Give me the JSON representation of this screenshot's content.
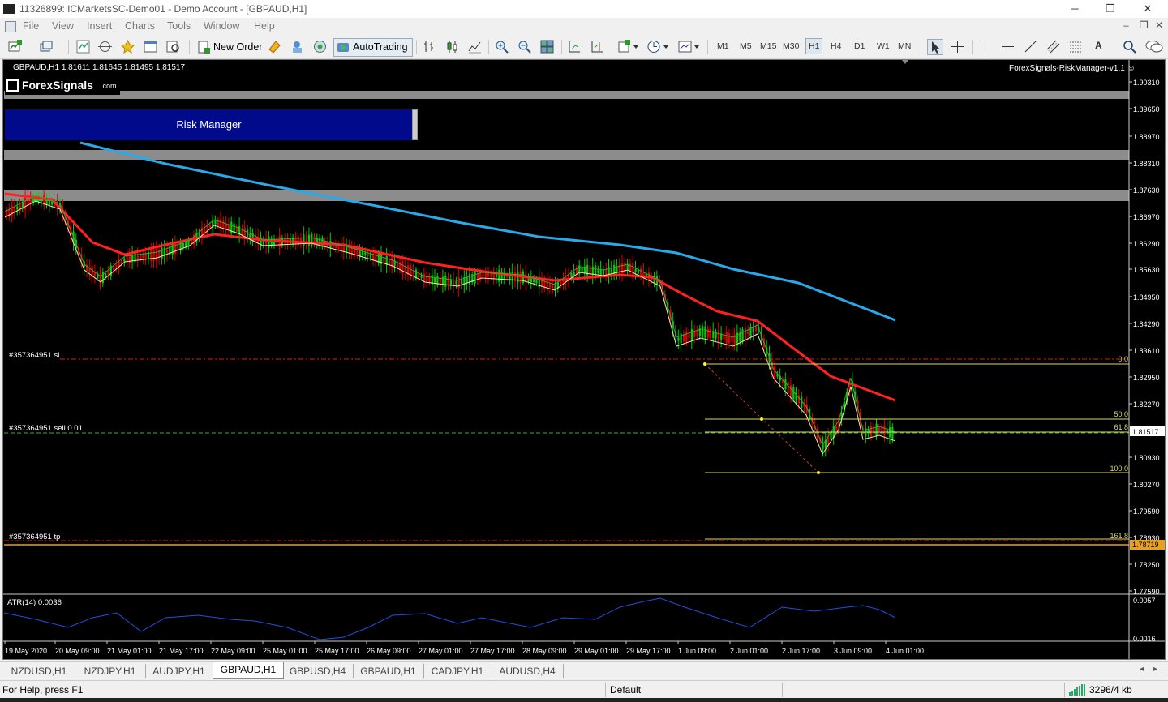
{
  "window": {
    "title": "11326899: ICMarketsSC-Demo01 - Demo Account - [GBPAUD,H1]",
    "minimize": "─",
    "restore": "❐",
    "close": "✕"
  },
  "menu": {
    "items": [
      "File",
      "View",
      "Insert",
      "Charts",
      "Tools",
      "Window",
      "Help"
    ],
    "mdi_min": "‒",
    "mdi_restore": "❐",
    "mdi_close": "✕"
  },
  "toolbar": {
    "new_order": "New Order",
    "autotrading": "AutoTrading",
    "timeframes": [
      "M1",
      "M5",
      "M15",
      "M30",
      "H1",
      "H4",
      "D1",
      "W1",
      "MN"
    ],
    "active_timeframe": "H1",
    "text_tool": "A"
  },
  "chart": {
    "info": "GBPAUD,H1  1.81611 1.81645 1.81495 1.81517",
    "ea_label": "ForexSignals-RiskManager-v1.1 ☺",
    "logo_text": "ForexSignals",
    "logo_suffix": ".com",
    "risk_manager_label": "Risk Manager",
    "order_sl": "#357364951 sl",
    "order_sell": "#357364951 sell 0.01",
    "order_tp": "#357364951 tp",
    "fib_levels": [
      "0.0",
      "50.0",
      "61.8",
      "100.0",
      "161.8"
    ],
    "price_axis": [
      "1.90310",
      "1.89650",
      "1.88970",
      "1.88310",
      "1.87630",
      "1.86970",
      "1.86290",
      "1.85630",
      "1.84950",
      "1.84290",
      "1.83610",
      "1.82950",
      "1.82270",
      "1.81517",
      "1.80930",
      "1.80270",
      "1.79590",
      "1.78930",
      "1.78719",
      "1.78250",
      "1.77590"
    ],
    "current_price": "1.81517",
    "tp_price": "1.78719",
    "time_axis": [
      "19 May 2020",
      "20 May 09:00",
      "21 May 01:00",
      "21 May 17:00",
      "22 May 09:00",
      "25 May 01:00",
      "25 May 17:00",
      "26 May 09:00",
      "27 May 01:00",
      "27 May 17:00",
      "28 May 09:00",
      "29 May 01:00",
      "29 May 17:00",
      "1 Jun 09:00",
      "2 Jun 01:00",
      "2 Jun 17:00",
      "3 Jun 09:00",
      "4 Jun 01:00"
    ],
    "atr_label": "ATR(14) 0.0036",
    "atr_axis_top": "0.0057",
    "atr_axis_bottom": "0.0016",
    "colors": {
      "up": "#00d000",
      "down": "#e00000",
      "ma_fast": "#ff2020",
      "ma_slow": "#2aa8e8",
      "atr": "#2050e0",
      "fib": "#d8d870",
      "sl": "#d02020",
      "sell": "#20c020"
    }
  },
  "tabs": [
    "NZDUSD,H1",
    "NZDJPY,H1",
    "AUDJPY,H1",
    "GBPAUD,H1",
    "GBPUSD,H4",
    "GBPAUD,H1",
    "CADJPY,H1",
    "AUDUSD,H4"
  ],
  "active_tab": "GBPAUD,H1",
  "status": {
    "help": "For Help, press F1",
    "profile": "Default",
    "traffic": "3296/4 kb"
  }
}
